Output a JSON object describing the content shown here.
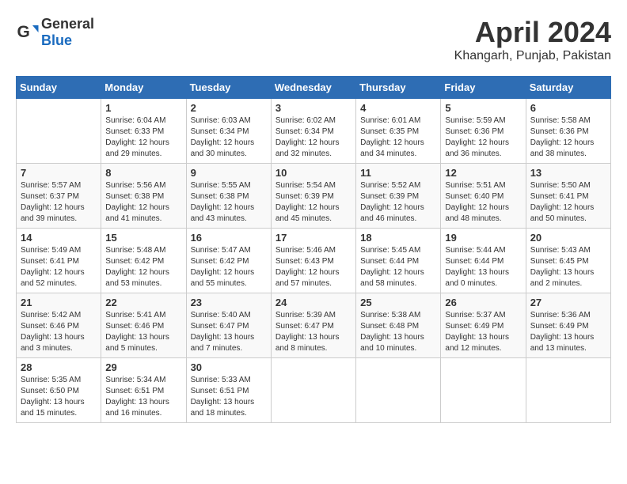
{
  "header": {
    "logo_general": "General",
    "logo_blue": "Blue",
    "month_title": "April 2024",
    "location": "Khangarh, Punjab, Pakistan"
  },
  "columns": [
    "Sunday",
    "Monday",
    "Tuesday",
    "Wednesday",
    "Thursday",
    "Friday",
    "Saturday"
  ],
  "weeks": [
    {
      "days": [
        {
          "num": "",
          "info": ""
        },
        {
          "num": "1",
          "info": "Sunrise: 6:04 AM\nSunset: 6:33 PM\nDaylight: 12 hours\nand 29 minutes."
        },
        {
          "num": "2",
          "info": "Sunrise: 6:03 AM\nSunset: 6:34 PM\nDaylight: 12 hours\nand 30 minutes."
        },
        {
          "num": "3",
          "info": "Sunrise: 6:02 AM\nSunset: 6:34 PM\nDaylight: 12 hours\nand 32 minutes."
        },
        {
          "num": "4",
          "info": "Sunrise: 6:01 AM\nSunset: 6:35 PM\nDaylight: 12 hours\nand 34 minutes."
        },
        {
          "num": "5",
          "info": "Sunrise: 5:59 AM\nSunset: 6:36 PM\nDaylight: 12 hours\nand 36 minutes."
        },
        {
          "num": "6",
          "info": "Sunrise: 5:58 AM\nSunset: 6:36 PM\nDaylight: 12 hours\nand 38 minutes."
        }
      ]
    },
    {
      "days": [
        {
          "num": "7",
          "info": "Sunrise: 5:57 AM\nSunset: 6:37 PM\nDaylight: 12 hours\nand 39 minutes."
        },
        {
          "num": "8",
          "info": "Sunrise: 5:56 AM\nSunset: 6:38 PM\nDaylight: 12 hours\nand 41 minutes."
        },
        {
          "num": "9",
          "info": "Sunrise: 5:55 AM\nSunset: 6:38 PM\nDaylight: 12 hours\nand 43 minutes."
        },
        {
          "num": "10",
          "info": "Sunrise: 5:54 AM\nSunset: 6:39 PM\nDaylight: 12 hours\nand 45 minutes."
        },
        {
          "num": "11",
          "info": "Sunrise: 5:52 AM\nSunset: 6:39 PM\nDaylight: 12 hours\nand 46 minutes."
        },
        {
          "num": "12",
          "info": "Sunrise: 5:51 AM\nSunset: 6:40 PM\nDaylight: 12 hours\nand 48 minutes."
        },
        {
          "num": "13",
          "info": "Sunrise: 5:50 AM\nSunset: 6:41 PM\nDaylight: 12 hours\nand 50 minutes."
        }
      ]
    },
    {
      "days": [
        {
          "num": "14",
          "info": "Sunrise: 5:49 AM\nSunset: 6:41 PM\nDaylight: 12 hours\nand 52 minutes."
        },
        {
          "num": "15",
          "info": "Sunrise: 5:48 AM\nSunset: 6:42 PM\nDaylight: 12 hours\nand 53 minutes."
        },
        {
          "num": "16",
          "info": "Sunrise: 5:47 AM\nSunset: 6:42 PM\nDaylight: 12 hours\nand 55 minutes."
        },
        {
          "num": "17",
          "info": "Sunrise: 5:46 AM\nSunset: 6:43 PM\nDaylight: 12 hours\nand 57 minutes."
        },
        {
          "num": "18",
          "info": "Sunrise: 5:45 AM\nSunset: 6:44 PM\nDaylight: 12 hours\nand 58 minutes."
        },
        {
          "num": "19",
          "info": "Sunrise: 5:44 AM\nSunset: 6:44 PM\nDaylight: 13 hours\nand 0 minutes."
        },
        {
          "num": "20",
          "info": "Sunrise: 5:43 AM\nSunset: 6:45 PM\nDaylight: 13 hours\nand 2 minutes."
        }
      ]
    },
    {
      "days": [
        {
          "num": "21",
          "info": "Sunrise: 5:42 AM\nSunset: 6:46 PM\nDaylight: 13 hours\nand 3 minutes."
        },
        {
          "num": "22",
          "info": "Sunrise: 5:41 AM\nSunset: 6:46 PM\nDaylight: 13 hours\nand 5 minutes."
        },
        {
          "num": "23",
          "info": "Sunrise: 5:40 AM\nSunset: 6:47 PM\nDaylight: 13 hours\nand 7 minutes."
        },
        {
          "num": "24",
          "info": "Sunrise: 5:39 AM\nSunset: 6:47 PM\nDaylight: 13 hours\nand 8 minutes."
        },
        {
          "num": "25",
          "info": "Sunrise: 5:38 AM\nSunset: 6:48 PM\nDaylight: 13 hours\nand 10 minutes."
        },
        {
          "num": "26",
          "info": "Sunrise: 5:37 AM\nSunset: 6:49 PM\nDaylight: 13 hours\nand 12 minutes."
        },
        {
          "num": "27",
          "info": "Sunrise: 5:36 AM\nSunset: 6:49 PM\nDaylight: 13 hours\nand 13 minutes."
        }
      ]
    },
    {
      "days": [
        {
          "num": "28",
          "info": "Sunrise: 5:35 AM\nSunset: 6:50 PM\nDaylight: 13 hours\nand 15 minutes."
        },
        {
          "num": "29",
          "info": "Sunrise: 5:34 AM\nSunset: 6:51 PM\nDaylight: 13 hours\nand 16 minutes."
        },
        {
          "num": "30",
          "info": "Sunrise: 5:33 AM\nSunset: 6:51 PM\nDaylight: 13 hours\nand 18 minutes."
        },
        {
          "num": "",
          "info": ""
        },
        {
          "num": "",
          "info": ""
        },
        {
          "num": "",
          "info": ""
        },
        {
          "num": "",
          "info": ""
        }
      ]
    }
  ]
}
